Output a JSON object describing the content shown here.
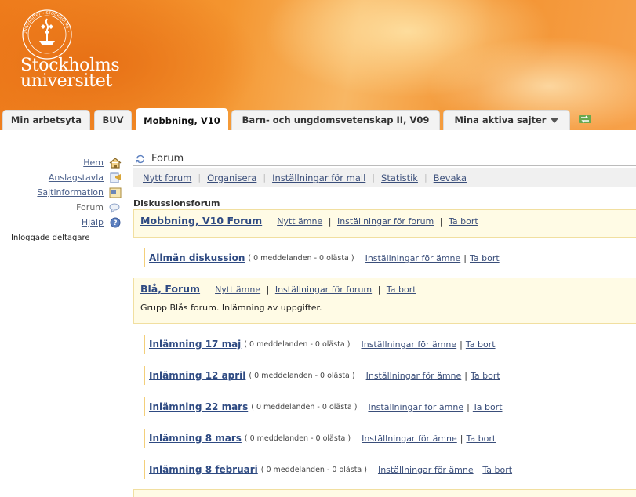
{
  "brand": {
    "line1": "Stockholms",
    "line2": "universitet",
    "seal_text": "UNIVERSITET • STOCKHOLMS •"
  },
  "tabs": [
    {
      "label": "Min arbetsyta",
      "active": false
    },
    {
      "label": "BUV",
      "active": false
    },
    {
      "label": "Mobbning, V10",
      "active": true
    },
    {
      "label": "Barn- och ungdomsvetenskap II, V09",
      "active": false
    },
    {
      "label": "Mina aktiva sajter",
      "active": false
    }
  ],
  "nav": {
    "items": [
      {
        "label": "Hem",
        "icon": "home-icon",
        "link": true
      },
      {
        "label": "Anslagstavla",
        "icon": "announcement-icon",
        "link": true
      },
      {
        "label": "Sajtinformation",
        "icon": "site-info-icon",
        "link": true
      },
      {
        "label": "Forum",
        "icon": "forum-icon",
        "link": false
      },
      {
        "label": "Hjälp",
        "icon": "help-icon",
        "link": true
      }
    ],
    "logged_in_label": "Inloggade deltagare"
  },
  "main": {
    "title": "Forum",
    "toolbar": [
      "Nytt forum",
      "Organisera",
      "Inställningar för mall",
      "Statistik",
      "Bevaka"
    ],
    "section_label": "Diskussionsforum"
  },
  "forum1": {
    "title": "Mobbning, V10 Forum",
    "new_topic": "Nytt ämne",
    "settings": "Inställningar för forum",
    "delete": "Ta bort"
  },
  "topic1": {
    "title": "Allmän diskussion",
    "meta": "( 0 meddelanden - 0 olästa )",
    "settings": "Inställningar för ämne",
    "delete": "Ta bort"
  },
  "forum2": {
    "title": "Blå, Forum",
    "new_topic": "Nytt ämne",
    "settings": "Inställningar för forum",
    "delete": "Ta bort",
    "description": "Grupp Blås forum. Inlämning av uppgifter."
  },
  "topics2": [
    {
      "title": "Inlämning 17 maj",
      "meta": "( 0 meddelanden - 0 olästa )",
      "settings": "Inställningar för ämne",
      "delete": "Ta bort"
    },
    {
      "title": "Inlämning 12 april",
      "meta": "( 0 meddelanden - 0 olästa )",
      "settings": "Inställningar för ämne",
      "delete": "Ta bort"
    },
    {
      "title": "Inlämning 22 mars",
      "meta": "( 0 meddelanden - 0 olästa )",
      "settings": "Inställningar för ämne",
      "delete": "Ta bort"
    },
    {
      "title": "Inlämning 8 mars",
      "meta": "( 0 meddelanden - 0 olästa )",
      "settings": "Inställningar för ämne",
      "delete": "Ta bort"
    },
    {
      "title": "Inlämning 8 februari",
      "meta": "( 0 meddelanden - 0 olästa )",
      "settings": "Inställningar för ämne",
      "delete": "Ta bort"
    }
  ],
  "colors": {
    "banner_orange": "#f4952f",
    "link_blue": "#3a4e7a",
    "forum_bg": "#fffbe5",
    "forum_border": "#f1dfa0"
  }
}
